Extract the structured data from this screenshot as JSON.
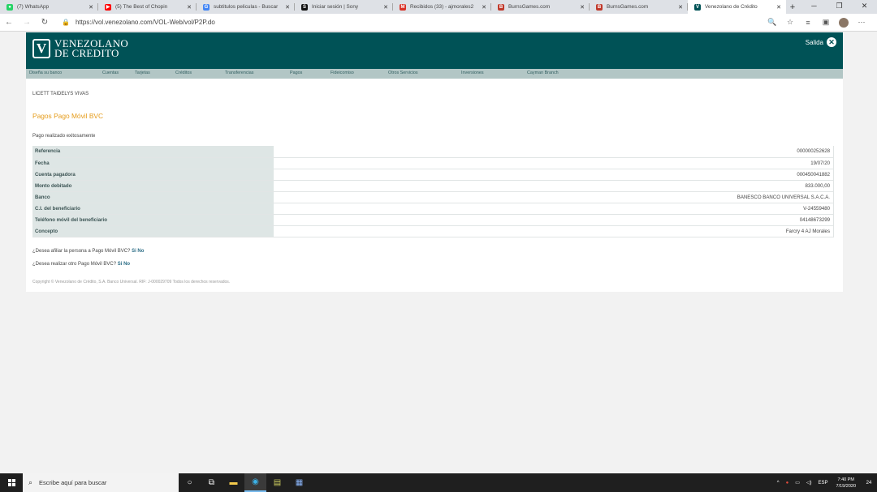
{
  "browser": {
    "tabs": [
      {
        "title": "(7) WhatsApp",
        "fav_color": "#25d366",
        "fav_glyph": "●",
        "active": false
      },
      {
        "title": "(5) The Best of Chopin",
        "fav_color": "#ff0000",
        "fav_glyph": "▶",
        "active": false
      },
      {
        "title": "subtitulos peliculas - Buscar",
        "fav_color": "#4285f4",
        "fav_glyph": "G",
        "active": false
      },
      {
        "title": "Iniciar sesión | Sony",
        "fav_color": "#111111",
        "fav_glyph": "S",
        "active": false
      },
      {
        "title": "Recibidos (33) - ajmorales2",
        "fav_color": "#d93025",
        "fav_glyph": "M",
        "active": false
      },
      {
        "title": "BurnsGames.com",
        "fav_color": "#c0392b",
        "fav_glyph": "B",
        "active": false
      },
      {
        "title": "BurnsGames.com",
        "fav_color": "#c0392b",
        "fav_glyph": "B",
        "active": false
      },
      {
        "title": "Venezolano de Crédito",
        "fav_color": "#005256",
        "fav_glyph": "V",
        "active": true
      }
    ],
    "url": "https://vol.venezolano.com/VOL-Web/vol/P2P.do"
  },
  "bank": {
    "logo_line1": "VENEZOLANO",
    "logo_line2": "DE CREDITO",
    "logo_letter": "V",
    "exit_label": "Salida",
    "menu": [
      {
        "label": "Diseña su banco"
      },
      {
        "label": "Cuentas"
      },
      {
        "label": "Tarjetas"
      },
      {
        "label": "Créditos"
      },
      {
        "label": "Transferencias"
      },
      {
        "label": "Pagos"
      },
      {
        "label": "Fideicomiso"
      },
      {
        "label": "Otros Servicios"
      },
      {
        "label": "Inversiones"
      },
      {
        "label": "Cayman Branch"
      }
    ]
  },
  "main": {
    "user_name": "LICETT TAIDELYS VIVAS",
    "page_title": "Pagos Pago Móvil BVC",
    "status": "Pago realizado exitosamente",
    "rows": [
      {
        "label": "Referencia",
        "value": "000000252628"
      },
      {
        "label": "Fecha",
        "value": "19/07/20"
      },
      {
        "label": "Cuenta pagadora",
        "value": "000450041882"
      },
      {
        "label": "Monto debitado",
        "value": "833.000,00"
      },
      {
        "label": "Banco",
        "value": "BANESCO BANCO UNIVERSAL S.A.C.A."
      },
      {
        "label": "C.I. del beneficiario",
        "value": "V-24559480"
      },
      {
        "label": "Teléfono móvil del beneficiario",
        "value": "04148673299"
      },
      {
        "label": "Concepto",
        "value": "Farcry 4 AJ Morales"
      }
    ],
    "question1": "¿Desea afiliar la persona a Pago Móvil BVC?",
    "question2": "¿Desea realizar otro Pago Móvil BVC?",
    "yes": "Si",
    "no": "No",
    "copyright": "Copyright © Venezolano de Crédito, S.A. Banco Universal. RIF: J-000029709 Todos los derechos reservados."
  },
  "taskbar": {
    "search_placeholder": "Escribe aquí para buscar",
    "lang": "ESP",
    "time": "7:40 PM",
    "date": "7/19/2020",
    "notif_count": "24"
  }
}
